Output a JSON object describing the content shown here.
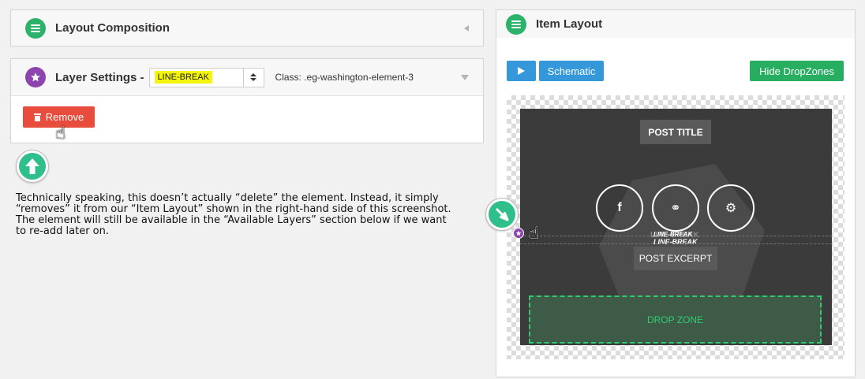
{
  "composition": {
    "title": "Layout Composition"
  },
  "layer_settings": {
    "title": "Layer Settings -",
    "selected_layer": "LINE-BREAK",
    "class_label": "Class:",
    "class_value": ".eg-washington-element-3",
    "remove_label": "Remove"
  },
  "description": "Technically speaking, this doesn’t actually “delete” the element.  Instead, it simply\n“removes” it from our “Item Layout” shown in the right-hand side of this screenshot.\nThe element will still be available in the “Available Layers” section below if we want\nto re-add later on.",
  "item_layout": {
    "title": "Item Layout",
    "schematic_label": "Schematic",
    "hide_dropzones_label": "Hide DropZones",
    "post_title": "POST TITLE",
    "social_icons": [
      "facebook-icon",
      "link-icon",
      "gears-icon"
    ],
    "social_glyphs": [
      "f",
      "⚭",
      "⚙"
    ],
    "line_break_ghost": "LINE-BREAK",
    "line_break": "LINE-BREAK",
    "post_excerpt": "POST EXCERPT",
    "drop_zone": "DROP ZONE"
  },
  "colors": {
    "green": "#2db26b",
    "purple": "#8e44ad",
    "red": "#e74c3c",
    "blue": "#3498db",
    "highlight": "#f5f50a",
    "teal_arrow": "#2fbf8b"
  }
}
